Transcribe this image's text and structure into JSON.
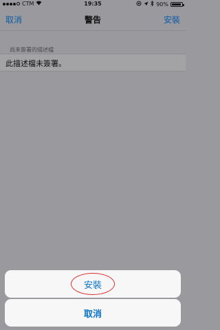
{
  "status_bar": {
    "carrier": "CTM",
    "time": "19:35",
    "battery_percent": "90%",
    "battery_level": 0.9
  },
  "nav": {
    "left_label": "取消",
    "title": "警告",
    "right_label": "安裝"
  },
  "section": {
    "header": "尚未簽署的描述檔",
    "row_text": "此描述檔未簽署。"
  },
  "action_sheet": {
    "install_label": "安裝",
    "cancel_label": "取消",
    "highlight_color": "#d9302b"
  },
  "colors": {
    "accent": "#0b72c8",
    "dim_background": "#9a9a9e"
  }
}
